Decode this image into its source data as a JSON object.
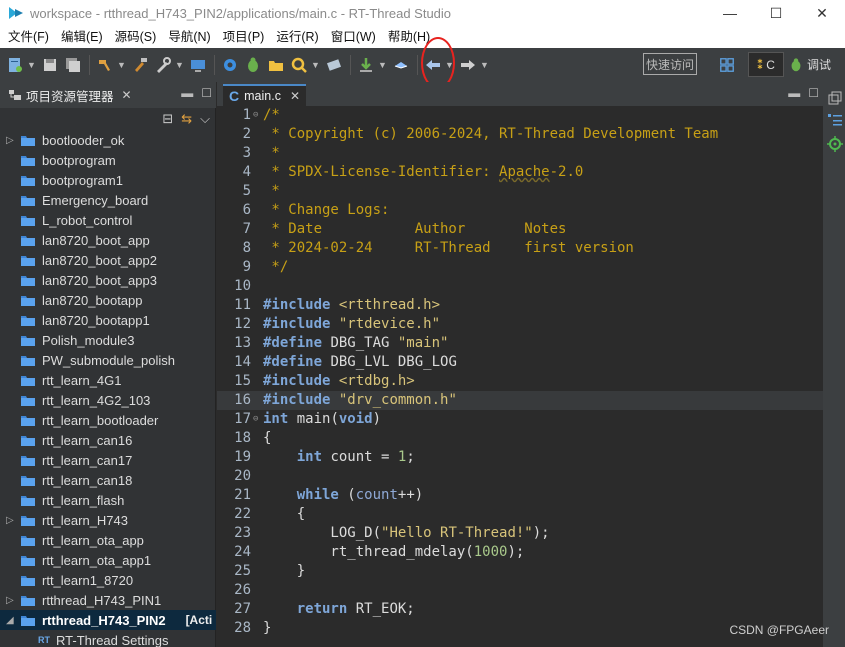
{
  "window": {
    "title": "workspace - rtthread_H743_PIN2/applications/main.c - RT-Thread Studio",
    "minimize": "—",
    "maximize": "☐",
    "close": "✕"
  },
  "menu": [
    "文件(F)",
    "编辑(E)",
    "源码(S)",
    "导航(N)",
    "项目(P)",
    "运行(R)",
    "窗口(W)",
    "帮助(H)"
  ],
  "toolbar": {
    "quick_access": "快速访问",
    "perspective_c": "C",
    "perspective_debug": "调试"
  },
  "project_explorer": {
    "tab_label": "项目资源管理器",
    "items": [
      {
        "label": "bootlooder_ok",
        "twisty": "▷"
      },
      {
        "label": "bootprogram",
        "twisty": ""
      },
      {
        "label": "bootprogram1",
        "twisty": ""
      },
      {
        "label": "Emergency_board",
        "twisty": ""
      },
      {
        "label": "L_robot_control",
        "twisty": ""
      },
      {
        "label": "lan8720_boot_app",
        "twisty": ""
      },
      {
        "label": "lan8720_boot_app2",
        "twisty": ""
      },
      {
        "label": "lan8720_boot_app3",
        "twisty": ""
      },
      {
        "label": "lan8720_bootapp",
        "twisty": ""
      },
      {
        "label": "lan8720_bootapp1",
        "twisty": ""
      },
      {
        "label": "Polish_module3",
        "twisty": ""
      },
      {
        "label": "PW_submodule_polish",
        "twisty": ""
      },
      {
        "label": "rtt_learn_4G1",
        "twisty": ""
      },
      {
        "label": "rtt_learn_4G2_103",
        "twisty": ""
      },
      {
        "label": "rtt_learn_bootloader",
        "twisty": ""
      },
      {
        "label": "rtt_learn_can16",
        "twisty": ""
      },
      {
        "label": "rtt_learn_can17",
        "twisty": ""
      },
      {
        "label": "rtt_learn_can18",
        "twisty": ""
      },
      {
        "label": "rtt_learn_flash",
        "twisty": ""
      },
      {
        "label": "rtt_learn_H743",
        "twisty": "▷"
      },
      {
        "label": "rtt_learn_ota_app",
        "twisty": ""
      },
      {
        "label": "rtt_learn_ota_app1",
        "twisty": ""
      },
      {
        "label": "rtt_learn1_8720",
        "twisty": ""
      },
      {
        "label": "rtthread_H743_PIN1",
        "twisty": "▷"
      }
    ],
    "active_item": {
      "label": "rtthread_H743_PIN2",
      "tag": "[Acti",
      "twisty": "◢"
    },
    "child_item": {
      "label": "RT-Thread Settings",
      "icon": "RT"
    }
  },
  "editor": {
    "tab_label": "main.c",
    "tab_icon": "C",
    "current_line": 16
  },
  "watermark": "CSDN @FPGAeer",
  "colors": {
    "background": "#2b2b2b",
    "comment": "#c7a016",
    "keyword": "#7ea6d8",
    "string": "#d8c47a",
    "annotation_circle": "#e8231f"
  }
}
